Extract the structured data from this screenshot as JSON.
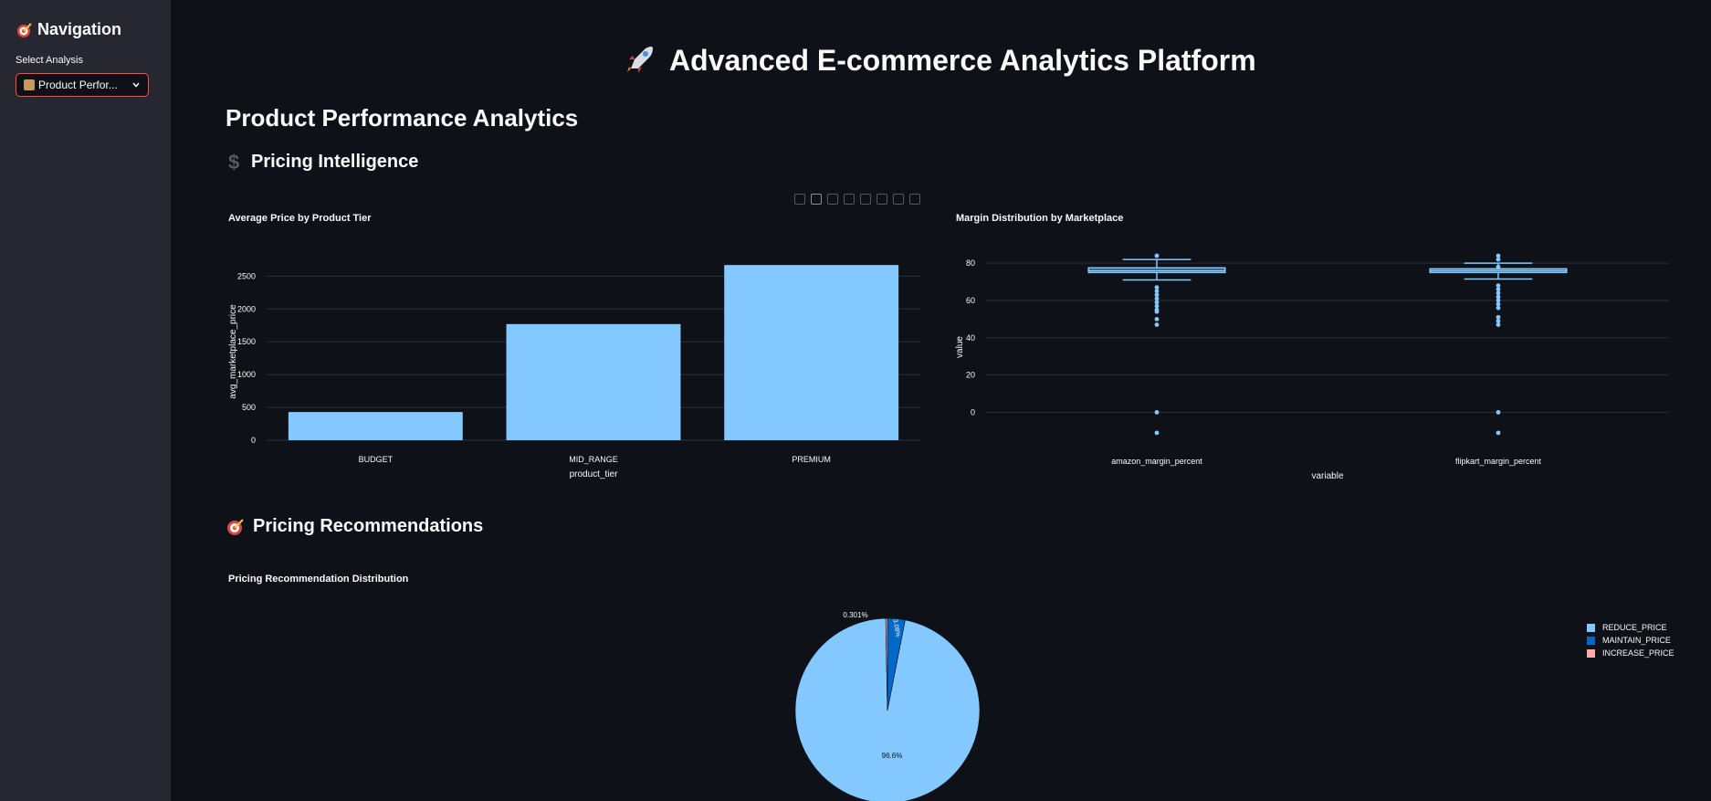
{
  "sidebar": {
    "title": "Navigation",
    "select_label": "Select Analysis",
    "select_value": "Product Perfor..."
  },
  "header": {
    "app_title": "Advanced E-commerce Analytics Platform"
  },
  "main": {
    "page_heading": "Product Performance Analytics",
    "section_pricing": "Pricing Intelligence",
    "section_recommendations": "Pricing Recommendations"
  },
  "colors": {
    "background": "#0e1117",
    "sidebar": "#262730",
    "accent": "#ff4b4b",
    "light_blue": "#83c9ff",
    "blue": "#0068c9",
    "pink": "#ffabab"
  },
  "chart_data": [
    {
      "type": "bar",
      "title": "Average Price by Product Tier",
      "xlabel": "product_tier",
      "ylabel": "avg_marketplace_price",
      "categories": [
        "BUDGET",
        "MID_RANGE",
        "PREMIUM"
      ],
      "values": [
        430,
        1770,
        2670
      ],
      "ylim": [
        0,
        2700
      ],
      "yticks": [
        0,
        500,
        1000,
        1500,
        2000,
        2500
      ],
      "grid": true
    },
    {
      "type": "box",
      "title": "Margin Distribution by Marketplace",
      "xlabel": "variable",
      "ylabel": "value",
      "categories": [
        "amazon_margin_percent",
        "flipkart_margin_percent"
      ],
      "ylim": [
        -14,
        84
      ],
      "yticks": [
        0,
        20,
        40,
        60,
        80
      ],
      "boxes": [
        {
          "name": "amazon_margin_percent",
          "whisker_low": 71,
          "q1": 75,
          "median": 76,
          "q3": 77.5,
          "whisker_high": 82,
          "outliers": [
            84,
            67,
            65,
            63,
            61,
            59,
            57,
            55,
            54,
            50,
            47,
            0,
            -11
          ]
        },
        {
          "name": "flipkart_margin_percent",
          "whisker_low": 71.5,
          "q1": 75,
          "median": 76,
          "q3": 77,
          "whisker_high": 80,
          "outliers": [
            84,
            82,
            78,
            68,
            66,
            64,
            62,
            60,
            58,
            56,
            51,
            49,
            47,
            0,
            -11
          ]
        }
      ]
    },
    {
      "type": "pie",
      "title": "Pricing Recommendation Distribution",
      "labels": [
        "REDUCE_PRICE",
        "MAINTAIN_PRICE",
        "INCREASE_PRICE"
      ],
      "values": [
        96.6,
        3.08,
        0.301
      ],
      "value_labels": [
        "96.6%",
        "3.08%",
        "0.301%"
      ],
      "colors": [
        "#83c9ff",
        "#0068c9",
        "#ffabab"
      ],
      "legend": "right"
    }
  ]
}
